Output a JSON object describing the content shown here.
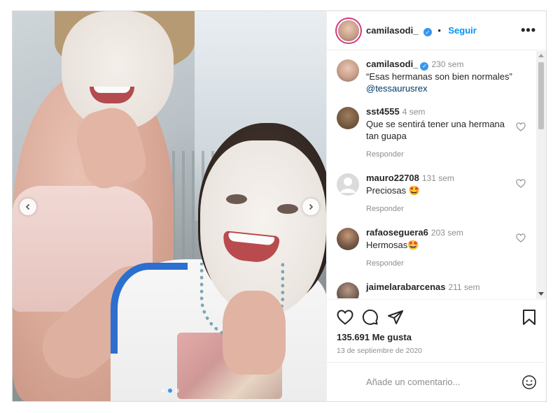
{
  "post": {
    "author": "camilasodi_",
    "follow_label": "Seguir",
    "more_label": "•••",
    "caption": {
      "user": "camilasodi_",
      "time": "230 sem",
      "text": "“Esas hermanas son bien normales”",
      "mention": "@tessaurusrex"
    },
    "comments": [
      {
        "user": "sst4555",
        "time": "4 sem",
        "text": "Que se sentirá tener una hermana tan guapa",
        "reply": "Responder"
      },
      {
        "user": "mauro22708",
        "time": "131 sem",
        "text": "Preciosas 🤩",
        "reply": "Responder"
      },
      {
        "user": "rafaoseguera6",
        "time": "203 sem",
        "text": "Hermosas🤩",
        "reply": "Responder"
      },
      {
        "user": "jaimelarabarcenas",
        "time": "211 sem"
      }
    ],
    "likes": "135.691 Me gusta",
    "date": "13 de septiembre de 2020",
    "add_comment_placeholder": "Añade un comentario...",
    "carousel": {
      "slides": 3,
      "active_index": 1
    }
  },
  "colors": {
    "link_blue": "#0095f6",
    "verified_blue": "#3897f0",
    "muted_text": "#8e8e8e",
    "carousel_active": "#3b95f6"
  },
  "icons": [
    "chevron-left-icon",
    "chevron-right-icon",
    "verified-icon",
    "more-icon",
    "heart-icon",
    "comment-icon",
    "share-icon",
    "bookmark-icon",
    "emoji-icon"
  ]
}
